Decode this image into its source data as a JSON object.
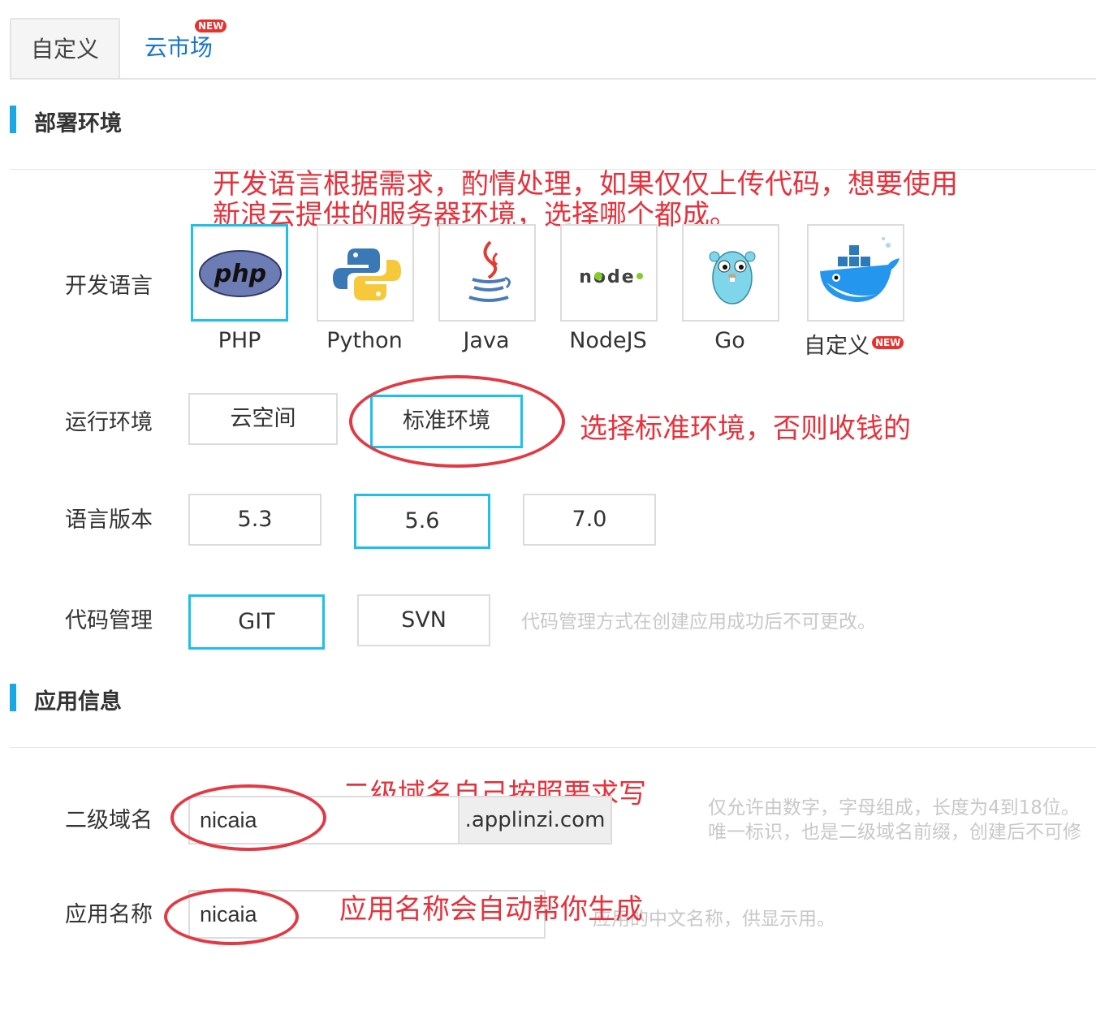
{
  "tabs": {
    "custom": "自定义",
    "cloud_market": "云市场",
    "new_badge": "NEW"
  },
  "deploy_section": {
    "title": "部署环境",
    "annotation_lines": [
      "开发语言根据需求，酌情处理，如果仅仅上传代码，想要使用",
      "新浪云提供的服务器环境，选择哪个都成。"
    ],
    "dev_language": {
      "label": "开发语言",
      "options": [
        "PHP",
        "Python",
        "Java",
        "NodeJS",
        "Go",
        "自定义"
      ],
      "selected": "PHP",
      "new_badge": "NEW",
      "icons": [
        "php-logo-icon",
        "python-logo-icon",
        "java-logo-icon",
        "nodejs-logo-icon",
        "go-gopher-icon",
        "docker-whale-icon"
      ],
      "node_logo_text": "node",
      "php_logo_text": "php"
    },
    "runtime": {
      "label": "运行环境",
      "options": [
        "云空间",
        "标准环境"
      ],
      "selected": "标准环境",
      "annotation": "选择标准环境，否则收钱的"
    },
    "version": {
      "label": "语言版本",
      "options": [
        "5.3",
        "5.6",
        "7.0"
      ],
      "selected": "5.6"
    },
    "code_mgmt": {
      "label": "代码管理",
      "options": [
        "GIT",
        "SVN"
      ],
      "selected": "GIT",
      "hint": "代码管理方式在创建应用成功后不可更改。"
    }
  },
  "app_section": {
    "title": "应用信息",
    "subdomain": {
      "label": "二级域名",
      "value": "nicaia",
      "suffix": ".applinzi.com",
      "annotation": "二级域名自己按照要求写",
      "hint_lines": [
        "仅允许由数字，字母组成，长度为4到18位。",
        "唯一标识，也是二级域名前缀，创建后不可修"
      ]
    },
    "app_name": {
      "label": "应用名称",
      "value": "nicaia",
      "annotation": "应用名称会自动帮你生成",
      "hint": "应用的中文名称，供显示用。"
    }
  },
  "colors": {
    "accent": "#1cc0ea",
    "section_bar": "#19a7e6",
    "annotation_red": "#e5323c",
    "link_blue": "#1677c9"
  }
}
